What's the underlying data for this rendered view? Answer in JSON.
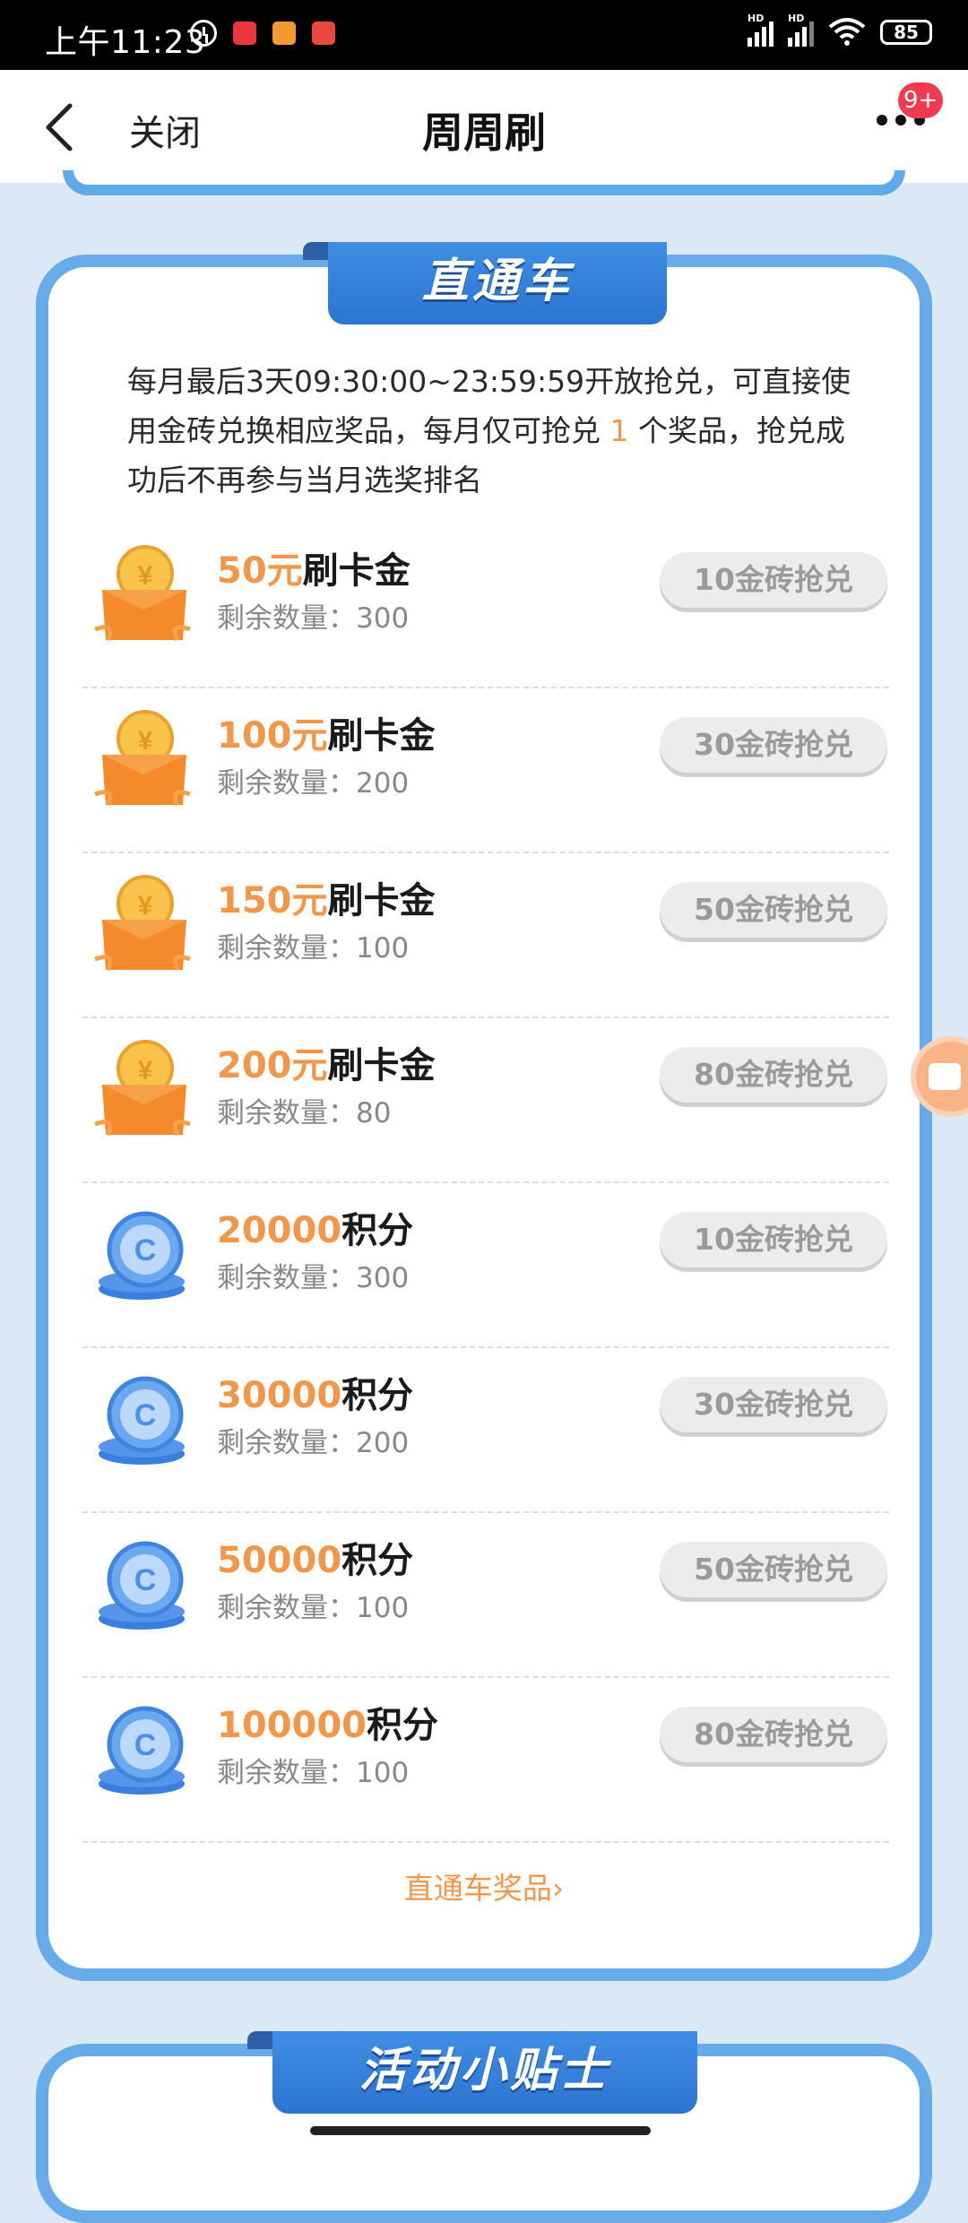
{
  "status_bar": {
    "time": "上午11:23",
    "battery": "85",
    "hd1": "HD",
    "hd2": "HD"
  },
  "header": {
    "close_label": "关闭",
    "title": "周周刷",
    "badge": "9+"
  },
  "section": {
    "title": "直通车",
    "desc_before": "每月最后3天09:30:00~23:59:59开放抢兑，可直接使用金砖兑换相应奖品，每月仅可抢兑 ",
    "desc_highlight": "1",
    "desc_after": " 个奖品，抢兑成功后不再参与当月选奖排名",
    "items": [
      {
        "amount": "50元",
        "name": "刷卡金",
        "remain": "剩余数量：300",
        "button": "10金砖抢兑",
        "icon": "gift-box-coin-icon"
      },
      {
        "amount": "100元",
        "name": "刷卡金",
        "remain": "剩余数量：200",
        "button": "30金砖抢兑",
        "icon": "gift-box-coin-icon"
      },
      {
        "amount": "150元",
        "name": "刷卡金",
        "remain": "剩余数量：100",
        "button": "50金砖抢兑",
        "icon": "gift-box-coin-icon"
      },
      {
        "amount": "200元",
        "name": "刷卡金",
        "remain": "剩余数量：80",
        "button": "80金砖抢兑",
        "icon": "gift-box-coin-icon"
      },
      {
        "amount": "20000",
        "name": "积分",
        "remain": "剩余数量：300",
        "button": "10金砖抢兑",
        "icon": "points-coin-stack-icon"
      },
      {
        "amount": "30000",
        "name": "积分",
        "remain": "剩余数量：200",
        "button": "30金砖抢兑",
        "icon": "points-coin-stack-icon"
      },
      {
        "amount": "50000",
        "name": "积分",
        "remain": "剩余数量：100",
        "button": "50金砖抢兑",
        "icon": "points-coin-stack-icon"
      },
      {
        "amount": "100000",
        "name": "积分",
        "remain": "剩余数量：100",
        "button": "80金砖抢兑",
        "icon": "points-coin-stack-icon"
      }
    ],
    "more_link": "直通车奖品",
    "more_arrow": "›"
  },
  "tips": {
    "title": "活动小贴士"
  },
  "colors": {
    "accent_orange": "#f2974a",
    "card_border": "#67ace9",
    "ribbon_blue": "#2c74d1",
    "background": "#dbe9f6"
  }
}
